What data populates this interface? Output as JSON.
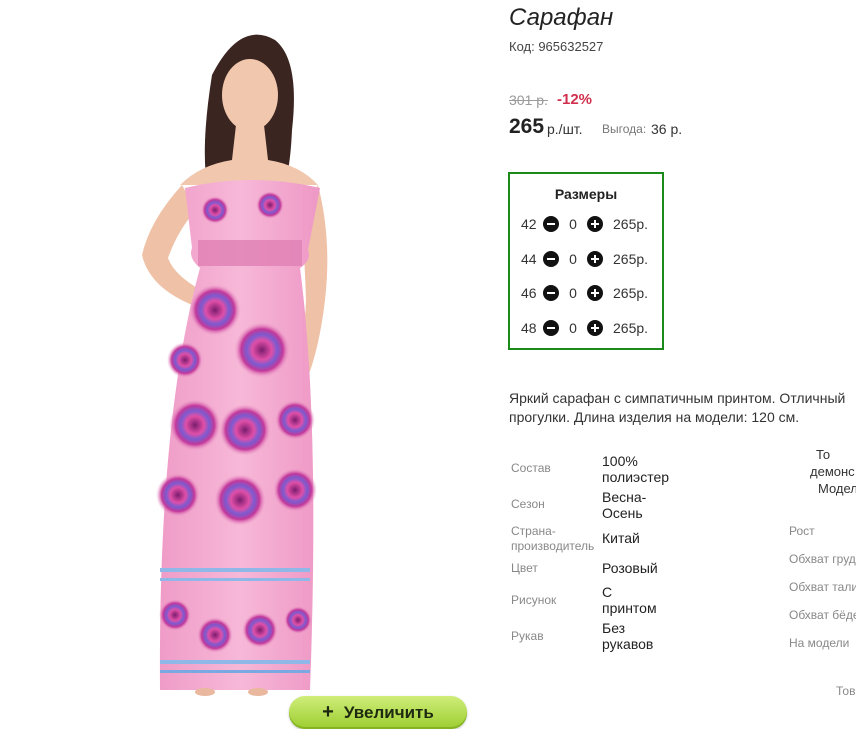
{
  "product": {
    "title": "Сарафан",
    "code": "Код: 965632527",
    "old_price": "301 р.",
    "discount": "-12%",
    "price": "265",
    "price_unit": "р./шт.",
    "saving_label": "Выгода:",
    "saving_value": "36 р.",
    "zoom_label": "Увеличить",
    "zoom_icon": "plus-icon"
  },
  "sizes": {
    "title": "Размеры",
    "rows": [
      {
        "size": "42",
        "qty": "0",
        "price": "265р."
      },
      {
        "size": "44",
        "qty": "0",
        "price": "265р."
      },
      {
        "size": "46",
        "qty": "0",
        "price": "265р."
      },
      {
        "size": "48",
        "qty": "0",
        "price": "265р."
      }
    ]
  },
  "description": {
    "line1": "Яркий сарафан с симпатичным принтом. Отличный",
    "line2": "прогулки. Длина изделия на модели: 120 см."
  },
  "specs": [
    {
      "label": "Состав",
      "value_l1": "100%",
      "value_l2": "полиэстер"
    },
    {
      "label": "Сезон",
      "value_l1": "Весна-",
      "value_l2": "Осень"
    },
    {
      "label_l1": "Страна-",
      "label_l2": "производитель",
      "value_l1": "Китай"
    },
    {
      "label": "Цвет",
      "value_l1": "Розовый"
    },
    {
      "label": "Рисунок",
      "value_l1": "С",
      "value_l2": "принтом"
    },
    {
      "label": "Рукав",
      "value_l1": "Без",
      "value_l2": "рукавов"
    }
  ],
  "model": {
    "header_l1": "То",
    "header_l2": "демонс",
    "header_l3": "Модел",
    "labels": [
      "Рост",
      "Обхват груди",
      "Обхват талии",
      "Обхват бёдер",
      "На модели"
    ],
    "more": "Тов"
  },
  "colors": {
    "accent_green": "#1a8a1a",
    "discount_red": "#d0304d",
    "zoom_button": "#b5de4a",
    "dress_pink": "#f3a8cf"
  }
}
